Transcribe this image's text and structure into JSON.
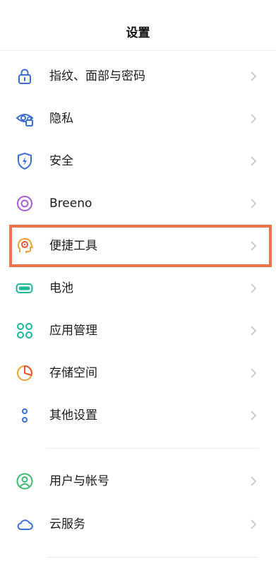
{
  "header": {
    "title": "设置"
  },
  "items": [
    {
      "label": "指纹、面部与密码",
      "icon": "lock-icon"
    },
    {
      "label": "隐私",
      "icon": "privacy-eye-icon"
    },
    {
      "label": "安全",
      "icon": "security-shield-icon"
    },
    {
      "label": "Breeno",
      "icon": "breeno-icon"
    },
    {
      "label": "便捷工具",
      "icon": "convenience-tools-icon"
    },
    {
      "label": "电池",
      "icon": "battery-icon"
    },
    {
      "label": "应用管理",
      "icon": "app-management-icon"
    },
    {
      "label": "存储空间",
      "icon": "storage-pie-icon"
    },
    {
      "label": "其他设置",
      "icon": "other-settings-icon"
    },
    {
      "label": "用户与帐号",
      "icon": "user-account-icon"
    },
    {
      "label": "云服务",
      "icon": "cloud-icon"
    }
  ],
  "highlighted_item": "便捷工具",
  "colors": {
    "highlight_border": "#f07346",
    "icon_blue": "#3b6fd8",
    "icon_purple": "#a95ad6",
    "icon_orange": "#f2a23a",
    "icon_teal": "#1fb59a",
    "icon_green": "#3dbb6c",
    "chevron": "#c4c4c4"
  }
}
